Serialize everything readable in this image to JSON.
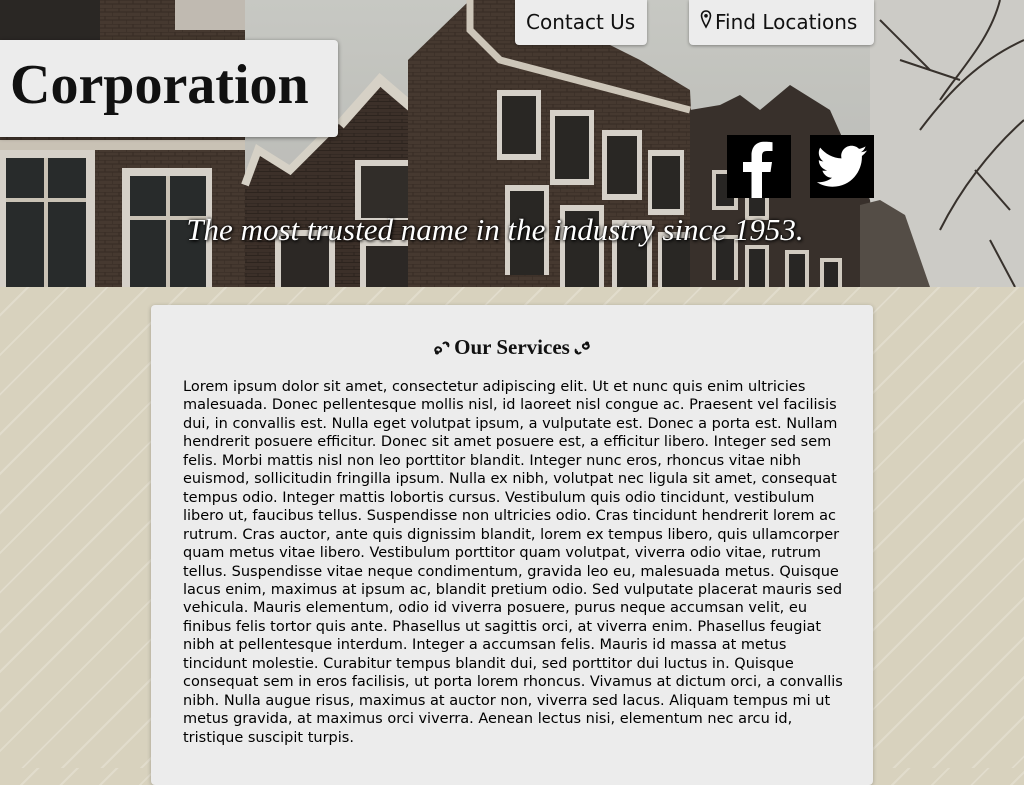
{
  "header": {
    "logo_text": "Corporation",
    "tagline": "The most trusted name in the industry since 1953."
  },
  "nav": {
    "contact_label": "Contact Us",
    "find_label": "Find Locations",
    "find_icon": "map-pin-icon"
  },
  "social": [
    {
      "name": "facebook",
      "icon": "facebook-icon"
    },
    {
      "name": "twitter",
      "icon": "twitter-icon"
    }
  ],
  "services": {
    "heading": "Our Services",
    "ornament_icon": "fleuron-icon",
    "body": "Lorem ipsum dolor sit amet, consectetur adipiscing elit. Ut et nunc quis enim ultricies malesuada. Donec pellentesque mollis nisl, id laoreet nisl congue ac. Praesent vel facilisis dui, in convallis est. Nulla eget volutpat ipsum, a vulputate est. Donec a porta est. Nullam hendrerit posuere efficitur. Donec sit amet posuere est, a efficitur libero. Integer sed sem felis. Morbi mattis nisl non leo porttitor blandit. Integer nunc eros, rhoncus vitae nibh euismod, sollicitudin fringilla ipsum. Nulla ex nibh, volutpat nec ligula sit amet, consequat tempus odio. Integer mattis lobortis cursus. Vestibulum quis odio tincidunt, vestibulum libero ut, faucibus tellus. Suspendisse non ultricies odio. Cras tincidunt hendrerit lorem ac rutrum. Cras auctor, ante quis dignissim blandit, lorem ex tempus libero, quis ullamcorper quam metus vitae libero. Vestibulum porttitor quam volutpat, viverra odio vitae, rutrum tellus. Suspendisse vitae neque condimentum, gravida leo eu, malesuada metus. Quisque lacus enim, maximus at ipsum ac, blandit pretium odio. Sed vulputate placerat mauris sed vehicula. Mauris elementum, odio id viverra posuere, purus neque accumsan velit, eu finibus felis tortor quis ante. Phasellus ut sagittis orci, at viverra enim. Phasellus feugiat nibh at pellentesque interdum. Integer a accumsan felis. Mauris id massa at metus tincidunt molestie. Curabitur tempus blandit dui, sed porttitor dui luctus in. Quisque consequat sem in eros facilisis, ut porta lorem rhoncus. Vivamus at dictum orci, a convallis nibh. Nulla augue risus, maximus at auctor non, viverra sed lacus. Aliquam tempus mi ut metus gravida, at maximus orci viverra. Aenean lectus nisi, elementum nec arcu id, tristique suscipit turpis."
  },
  "colors": {
    "page_background": "#d8d2be",
    "panel_background": "#ececec",
    "text": "#111111",
    "social_background": "#000000"
  }
}
